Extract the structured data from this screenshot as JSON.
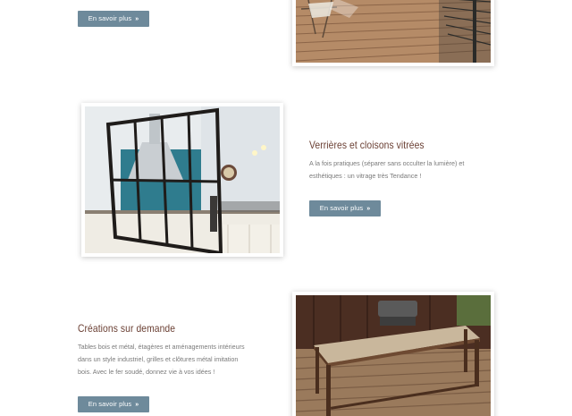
{
  "colors": {
    "button_bg": "#6e8a9b",
    "title": "#6a3f33",
    "text": "#7a7a7a"
  },
  "sections": [
    {
      "button": {
        "label": "En savoir plus",
        "icon": "double-chevron-right-icon"
      },
      "image": "wooden-deck-with-deck-chair"
    },
    {
      "title": "Verrières et cloisons vitrées",
      "description_lines": [
        "A la fois pratiques (séparer sans occulter la lumière) et",
        "esthétiques : un vitrage très Tendance !"
      ],
      "button": {
        "label": "En savoir plus",
        "icon": "double-chevron-right-icon"
      },
      "image": "kitchen-glass-partition"
    },
    {
      "title": "Créations sur demande",
      "description_lines": [
        "Tables bois et métal, étagères et aménagements intérieurs",
        "dans un style industriel, grilles et clôtures métal imitation",
        "bois. Avec le fer soudé, donnez vie à vos idées !"
      ],
      "button": {
        "label": "En savoir plus",
        "icon": "double-chevron-right-icon"
      },
      "image": "wood-metal-table-on-terrace"
    }
  ]
}
